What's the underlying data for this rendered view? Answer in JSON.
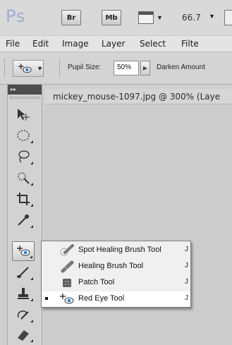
{
  "appbar": {
    "logo": "Ps",
    "bridge_label": "Br",
    "minibridge_label": "Mb",
    "zoom_level": "66.7",
    "arrange_icon": "arrange-documents-icon"
  },
  "menubar": {
    "items": [
      "File",
      "Edit",
      "Image",
      "Layer",
      "Select",
      "Filte"
    ]
  },
  "options_bar": {
    "tool_icon": "red-eye-tool-icon",
    "pupil_size_label": "Pupil Size:",
    "pupil_size_value": "50%",
    "darken_amount_label": "Darken Amount"
  },
  "document": {
    "tab_title": "mickey_mouse-1097.jpg @ 300% (Laye"
  },
  "tools": {
    "collapse_label": "▸▸",
    "items": [
      {
        "name": "move-tool-icon"
      },
      {
        "name": "elliptical-marquee-tool-icon"
      },
      {
        "name": "lasso-tool-icon"
      },
      {
        "name": "quick-selection-tool-icon"
      },
      {
        "name": "crop-tool-icon"
      },
      {
        "name": "eyedropper-tool-icon"
      },
      {
        "name": "red-eye-tool-icon"
      },
      {
        "name": "brush-tool-icon"
      },
      {
        "name": "clone-stamp-tool-icon"
      },
      {
        "name": "history-brush-tool-icon"
      },
      {
        "name": "eraser-tool-icon"
      }
    ]
  },
  "flyout": {
    "items": [
      {
        "label": "Spot Healing Brush Tool",
        "shortcut": "J",
        "icon": "spot-healing-brush-icon",
        "selected": false
      },
      {
        "label": "Healing Brush Tool",
        "shortcut": "J",
        "icon": "healing-brush-icon",
        "selected": false
      },
      {
        "label": "Patch Tool",
        "shortcut": "J",
        "icon": "patch-tool-icon",
        "selected": false
      },
      {
        "label": "Red Eye Tool",
        "shortcut": "J",
        "icon": "red-eye-tool-icon",
        "selected": true
      }
    ]
  },
  "colors": {
    "logo": "#9eaecf",
    "accent_blue": "#2f7fd0",
    "panel_dark": "#4d4d4d"
  }
}
